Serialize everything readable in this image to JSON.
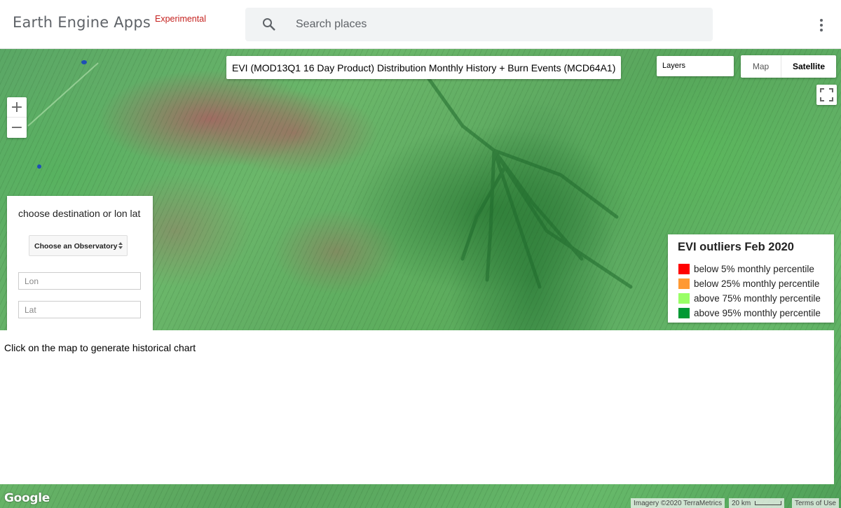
{
  "app": {
    "title": "Earth Engine Apps",
    "tag": "Experimental"
  },
  "search": {
    "placeholder": "Search places",
    "icon": "search-icon"
  },
  "map": {
    "title": "EVI (MOD13Q1 16 Day Product) Distribution Monthly History + Burn Events (MCD64A1)",
    "layers_label": "Layers",
    "map_type": {
      "map_label": "Map",
      "satellite_label": "Satellite",
      "selected": "Satellite"
    },
    "zoom_in": "+",
    "zoom_out": "−",
    "attribution": "Imagery ©2020 TerraMetrics",
    "scale_label": "20 km",
    "terms": "Terms of Use",
    "google_logo": "Google"
  },
  "side_panel": {
    "title": "choose destination or lon lat",
    "observatory_select": "Choose an Observatory",
    "lon_placeholder": "Lon",
    "lat_placeholder": "Lat"
  },
  "legend": {
    "title": "EVI outliers Feb 2020",
    "items": [
      {
        "label": "below 5% monthly percentile",
        "color": "#ff0000"
      },
      {
        "label": "below 25% monthly percentile",
        "color": "#ff9933"
      },
      {
        "label": "above 75% monthly percentile",
        "color": "#99ff66"
      },
      {
        "label": "above 95% monthly percentile",
        "color": "#009933"
      }
    ]
  },
  "chart_panel": {
    "message": "Click on the map to generate historical chart"
  }
}
